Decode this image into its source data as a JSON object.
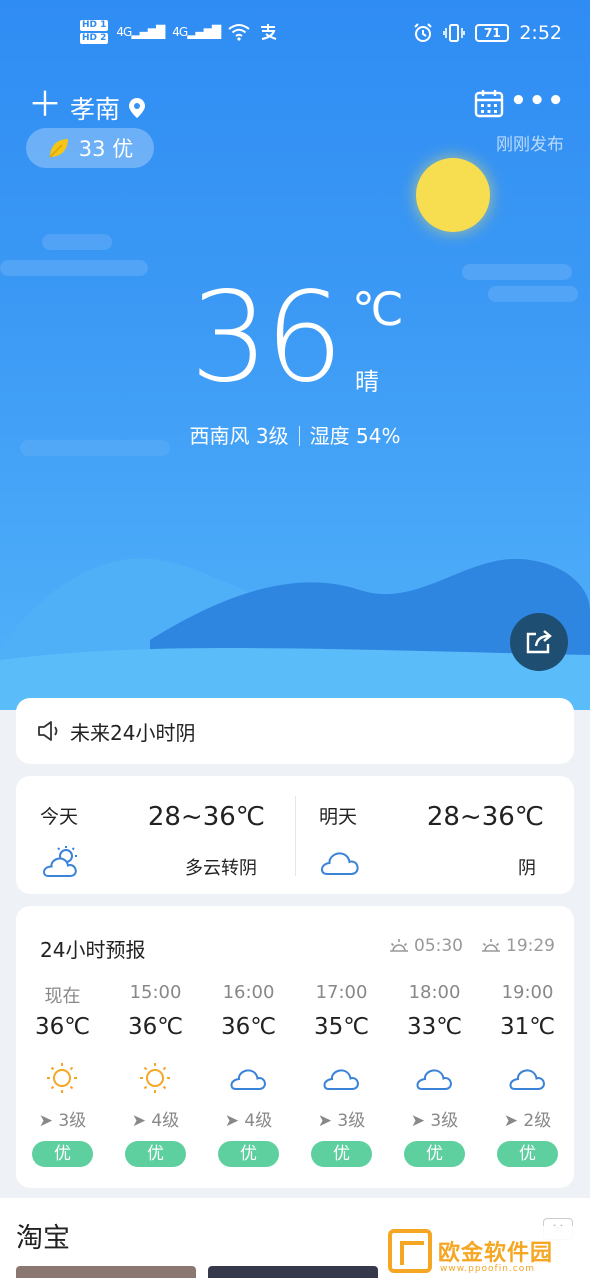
{
  "status_bar": {
    "hd1": "HD 1",
    "hd2": "HD 2",
    "signal1": "4G",
    "signal2": "4G",
    "battery": "71",
    "time": "2:52"
  },
  "header": {
    "city": "孝南",
    "aqi_value": "33 优",
    "publish_time": "刚刚发布"
  },
  "current": {
    "temperature": "36",
    "unit": "℃",
    "condition": "晴",
    "wind": "西南风 3级",
    "humidity": "湿度 54%"
  },
  "notice": {
    "text": "未来24小时阴"
  },
  "days": [
    {
      "name": "今天",
      "range": "28~36℃",
      "condition": "多云转阴",
      "icon": "partly-cloudy-icon"
    },
    {
      "name": "明天",
      "range": "28~36℃",
      "condition": "阴",
      "icon": "cloudy-icon"
    }
  ],
  "hourly": {
    "title": "24小时预报",
    "sunrise": "05:30",
    "sunset": "19:29",
    "hours": [
      {
        "time": "现在",
        "temp": "36℃",
        "icon": "sunny-icon",
        "wind": "3级",
        "aqi": "优"
      },
      {
        "time": "15:00",
        "temp": "36℃",
        "icon": "sunny-icon",
        "wind": "4级",
        "aqi": "优"
      },
      {
        "time": "16:00",
        "temp": "36℃",
        "icon": "cloudy-icon",
        "wind": "4级",
        "aqi": "优"
      },
      {
        "time": "17:00",
        "temp": "35℃",
        "icon": "cloudy-icon",
        "wind": "3级",
        "aqi": "优"
      },
      {
        "time": "18:00",
        "temp": "33℃",
        "icon": "cloudy-icon",
        "wind": "3级",
        "aqi": "优"
      },
      {
        "time": "19:00",
        "temp": "31℃",
        "icon": "cloudy-icon",
        "wind": "2级",
        "aqi": "优"
      }
    ]
  },
  "ad": {
    "title": "淘宝",
    "close": "×"
  },
  "watermark": {
    "text": "欧金软件园",
    "sub": "www.ppoofin.com"
  },
  "colors": {
    "sky_top": "#2f8cf3",
    "sky_bottom": "#52b2fa",
    "sun": "#f7dd50",
    "aqi_badge": "#5ecf9f",
    "icon_blue": "#3a83d8",
    "icon_orange": "#f5a623"
  }
}
